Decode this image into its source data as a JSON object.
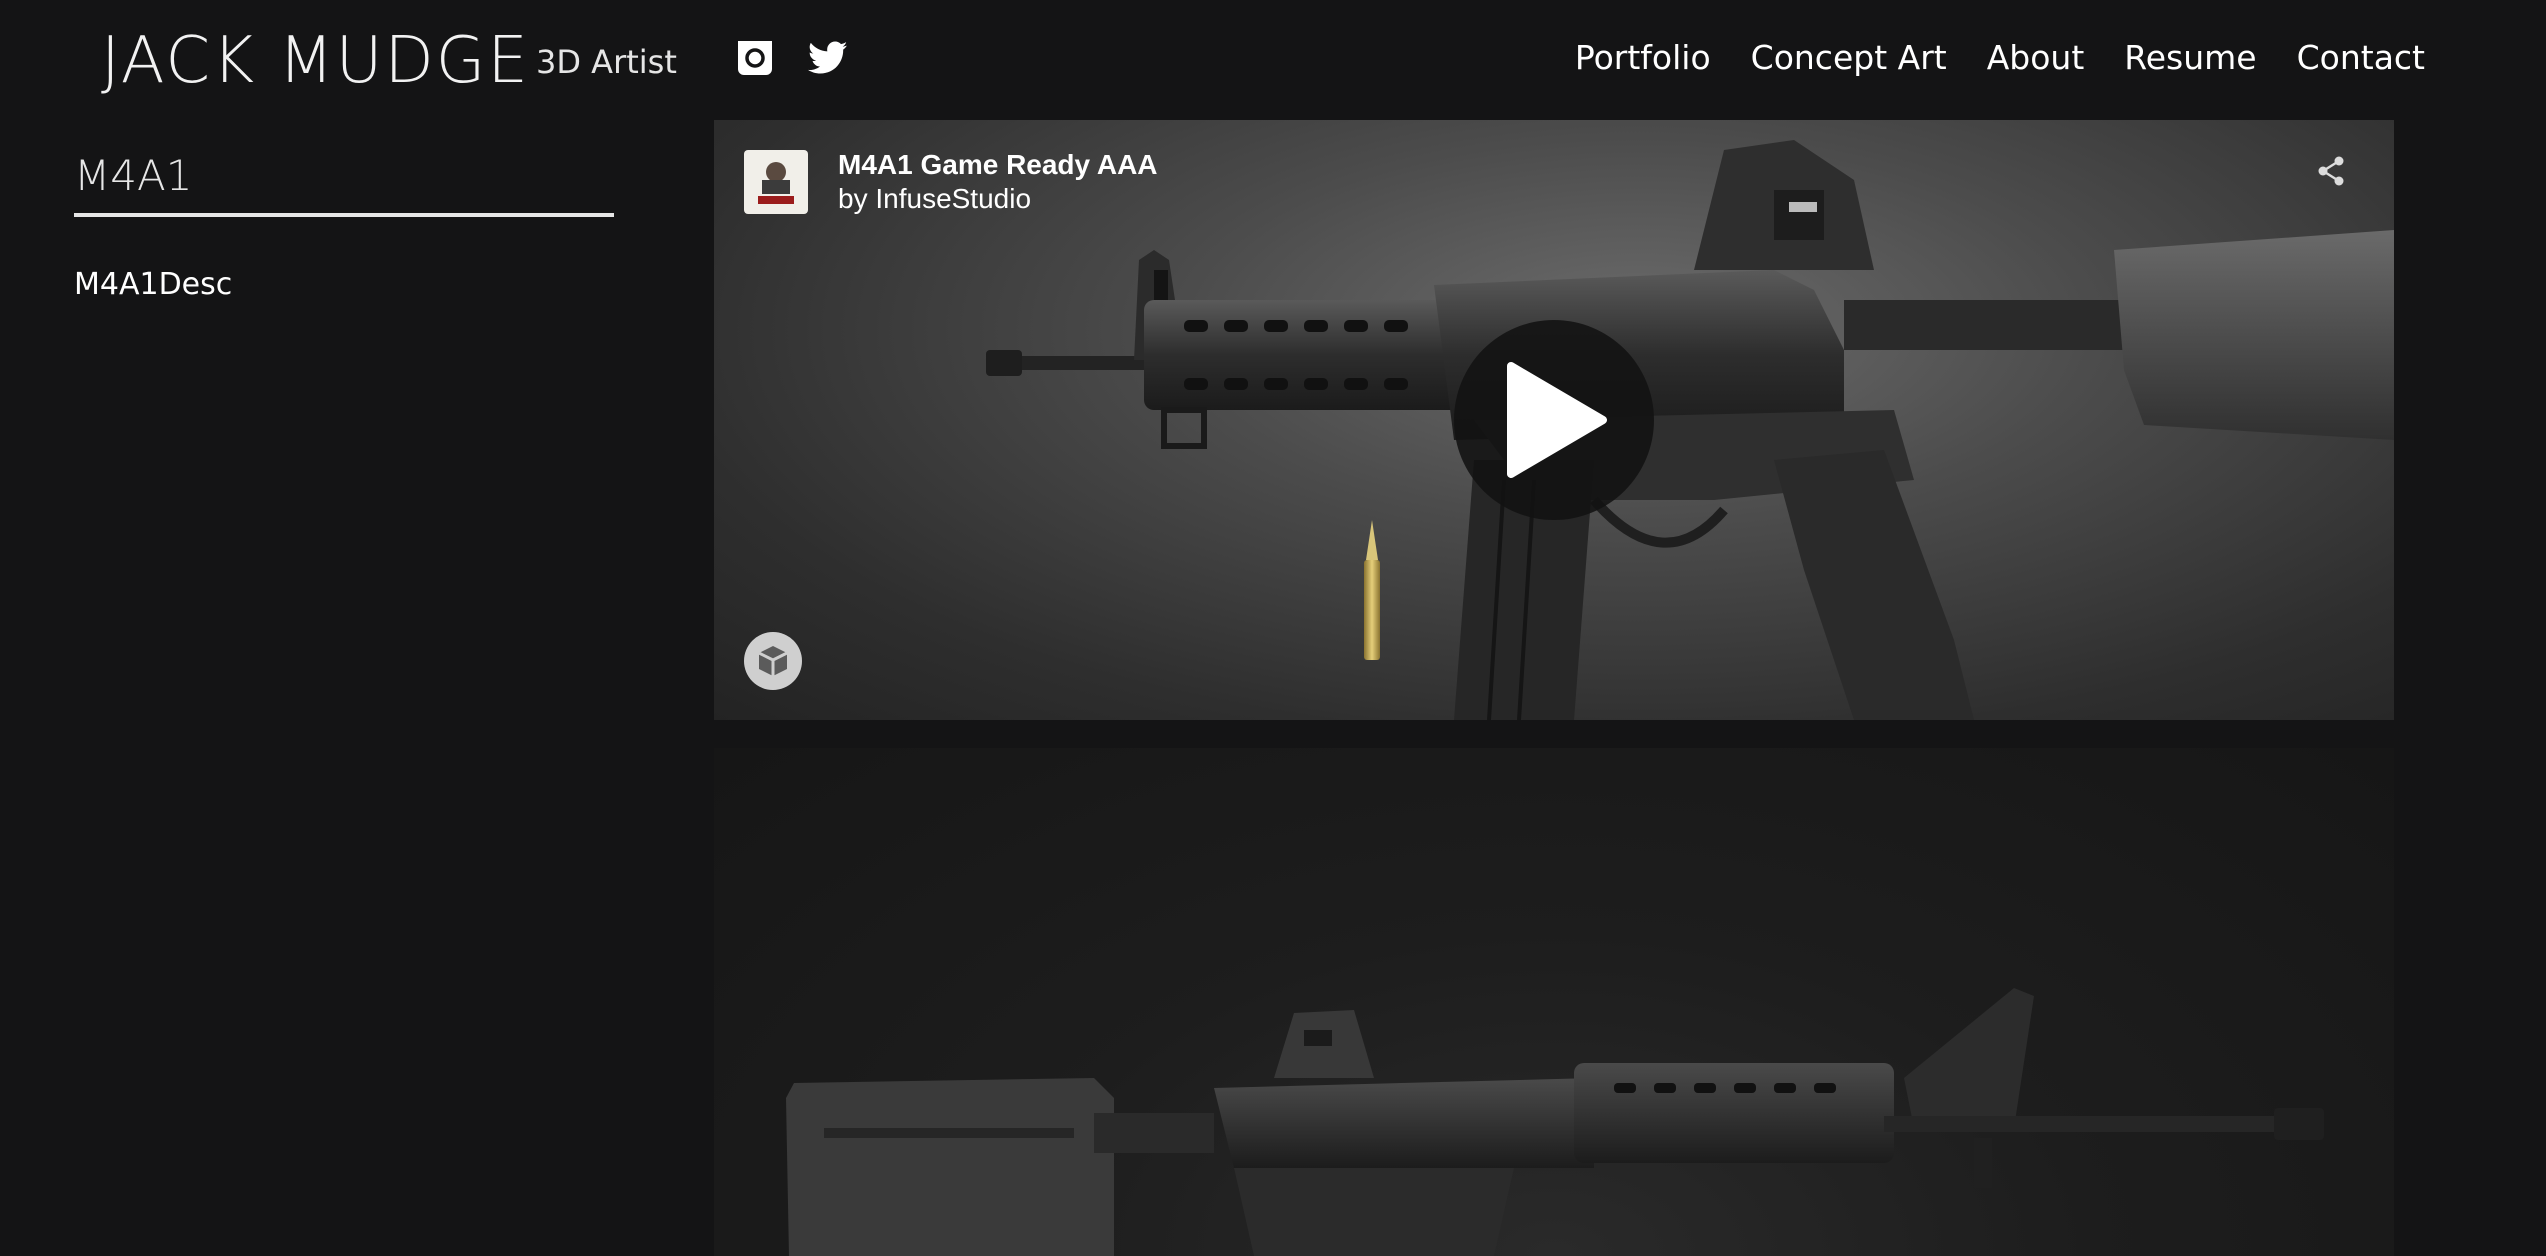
{
  "header": {
    "brand": "JACK MUDGE",
    "tagline": "3D Artist",
    "social": [
      {
        "icon": "instagram-icon"
      },
      {
        "icon": "twitter-icon"
      }
    ],
    "nav": [
      "Portfolio",
      "Concept Art",
      "About",
      "Resume",
      "Contact"
    ]
  },
  "project": {
    "title": "M4A1",
    "description": "M4A1Desc"
  },
  "viewer": {
    "model_title": "M4A1 Game Ready AAA",
    "by_prefix": "by",
    "author": "InfuseStudio",
    "icons": [
      "share-icon",
      "play-icon",
      "sketchfab-logo-icon"
    ]
  },
  "colors": {
    "background": "#141415",
    "text": "#ffffff",
    "viewer_bg": "#4c4c4c",
    "play_button": "#121212"
  }
}
